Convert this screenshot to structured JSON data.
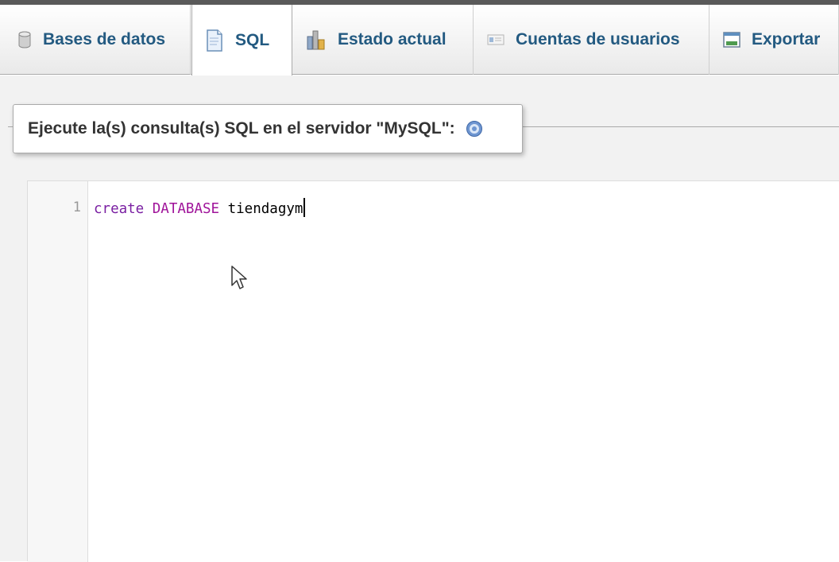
{
  "tabs": [
    {
      "label": "Bases de datos",
      "icon": "database-icon"
    },
    {
      "label": "SQL",
      "icon": "sql-document-icon",
      "active": true
    },
    {
      "label": "Estado actual",
      "icon": "status-chart-icon"
    },
    {
      "label": "Cuentas de usuarios",
      "icon": "users-card-icon"
    },
    {
      "label": "Exportar",
      "icon": "export-icon"
    }
  ],
  "query_panel": {
    "legend": "Ejecute la(s) consulta(s) SQL en el servidor \"MySQL\":",
    "help_icon": "help-icon"
  },
  "editor": {
    "line_number": "1",
    "code": {
      "keyword1": "create",
      "keyword2": "DATABASE",
      "identifier": "tiendagym"
    }
  },
  "colors": {
    "tab_text": "#235a81",
    "keyword": "#a0149a"
  }
}
